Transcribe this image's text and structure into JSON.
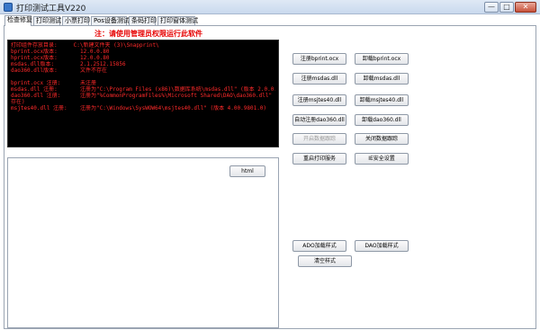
{
  "window": {
    "title": "打印测试工具V220",
    "min_glyph": "—",
    "max_glyph": "□",
    "close_glyph": "✕"
  },
  "tabs": [
    "检查修复",
    "打印测试",
    "小票打印",
    "Pos设备测试",
    "条码打印",
    "打印窗体测试"
  ],
  "notice": "注：请使用管理员权限运行此软件",
  "console_lines": [
    "打印组件存放目录:     C:\\新建文件夹 (3)\\Snapprint\\",
    "bprint.ocx版本:       12.0.0.80",
    "hprint.ocx版本:       12.0.0.80",
    "msdas.dll版本:        2.1.2512.15856",
    "dao360.dll版本:       文件不存在",
    "",
    "bprint.ocx 注册:      未注册",
    "msdas.dll 注册:       注册为\"C:\\Program Files (x86)\\数据库系统\\msdas.dll\" (版本 2.0.0.10)",
    "dao360.dll 注册:      注册为\"%CommonProgramFiles%\\Microsoft Shared\\DAO\\dao360.dll\" (版本 文件不",
    "存在)",
    "msjtes40.dll 注册:    注册为\"C:\\Windows\\SysWOW64\\msjtes40.dll\" (版本 4.00.9801.0)"
  ],
  "lower": {
    "html_button": "html"
  },
  "buttons": {
    "reg_bprint": "注册bprint.ocx",
    "unreg_bprint": "卸载bprint.ocx",
    "reg_msdas": "注册msdas.dll",
    "unreg_msdas": "卸载msdas.dll",
    "reg_msjtes": "注册msjtes40.dll",
    "unreg_msjtes": "卸载msjtes40.dll",
    "auto_reg_dao": "自动注册dao360.dll",
    "unreg_dao": "卸载dao360.dll",
    "start_trace": "开启数据跟踪",
    "stop_trace": "关闭数据跟踪",
    "restart_spooler": "重启打印服务",
    "ie_security": "IE安全设置",
    "ado_style": "ADO加载样式",
    "dao_style": "DAO加载样式",
    "clear_style": "清空样式"
  }
}
